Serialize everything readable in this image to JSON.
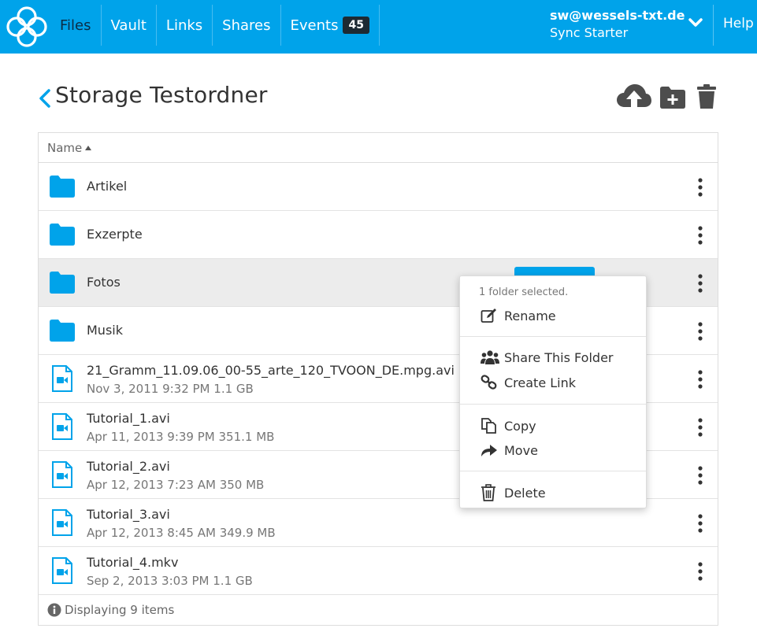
{
  "topbar": {
    "nav": [
      {
        "label": "Files",
        "active": true
      },
      {
        "label": "Vault"
      },
      {
        "label": "Links"
      },
      {
        "label": "Shares"
      },
      {
        "label": "Events",
        "badge": "45"
      }
    ],
    "account_email": "sw@wessels-txt.de",
    "account_plan": "Sync Starter",
    "help_label": "Help"
  },
  "page": {
    "title": "Storage Testordner"
  },
  "table": {
    "column_name": "Name",
    "rows": [
      {
        "type": "folder",
        "name": "Artikel"
      },
      {
        "type": "folder",
        "name": "Exzerpte"
      },
      {
        "type": "folder",
        "name": "Fotos",
        "selected": true
      },
      {
        "type": "folder",
        "name": "Musik"
      },
      {
        "type": "file",
        "name": "21_Gramm_11.09.06_00-55_arte_120_TVOON_DE.mpg.avi",
        "meta": "Nov 3, 2011 9:32 PM 1.1 GB"
      },
      {
        "type": "file",
        "name": "Tutorial_1.avi",
        "meta": "Apr 11, 2013 9:39 PM 351.1 MB"
      },
      {
        "type": "file",
        "name": "Tutorial_2.avi",
        "meta": "Apr 12, 2013 7:23 AM 350 MB"
      },
      {
        "type": "file",
        "name": "Tutorial_3.avi",
        "meta": "Apr 12, 2013 8:45 AM 349.9 MB"
      },
      {
        "type": "file",
        "name": "Tutorial_4.mkv",
        "meta": "Sep 2, 2013 3:03 PM 1.1 GB"
      }
    ],
    "footer": "Displaying 9 items"
  },
  "context_menu": {
    "header": "1 folder selected.",
    "rename": "Rename",
    "share": "Share This Folder",
    "create_link": "Create Link",
    "copy": "Copy",
    "move": "Move",
    "delete": "Delete"
  },
  "colors": {
    "brand": "#00a3ea",
    "badge_bg": "#1d2a33",
    "toolbar_icon": "#4d4d4d"
  }
}
